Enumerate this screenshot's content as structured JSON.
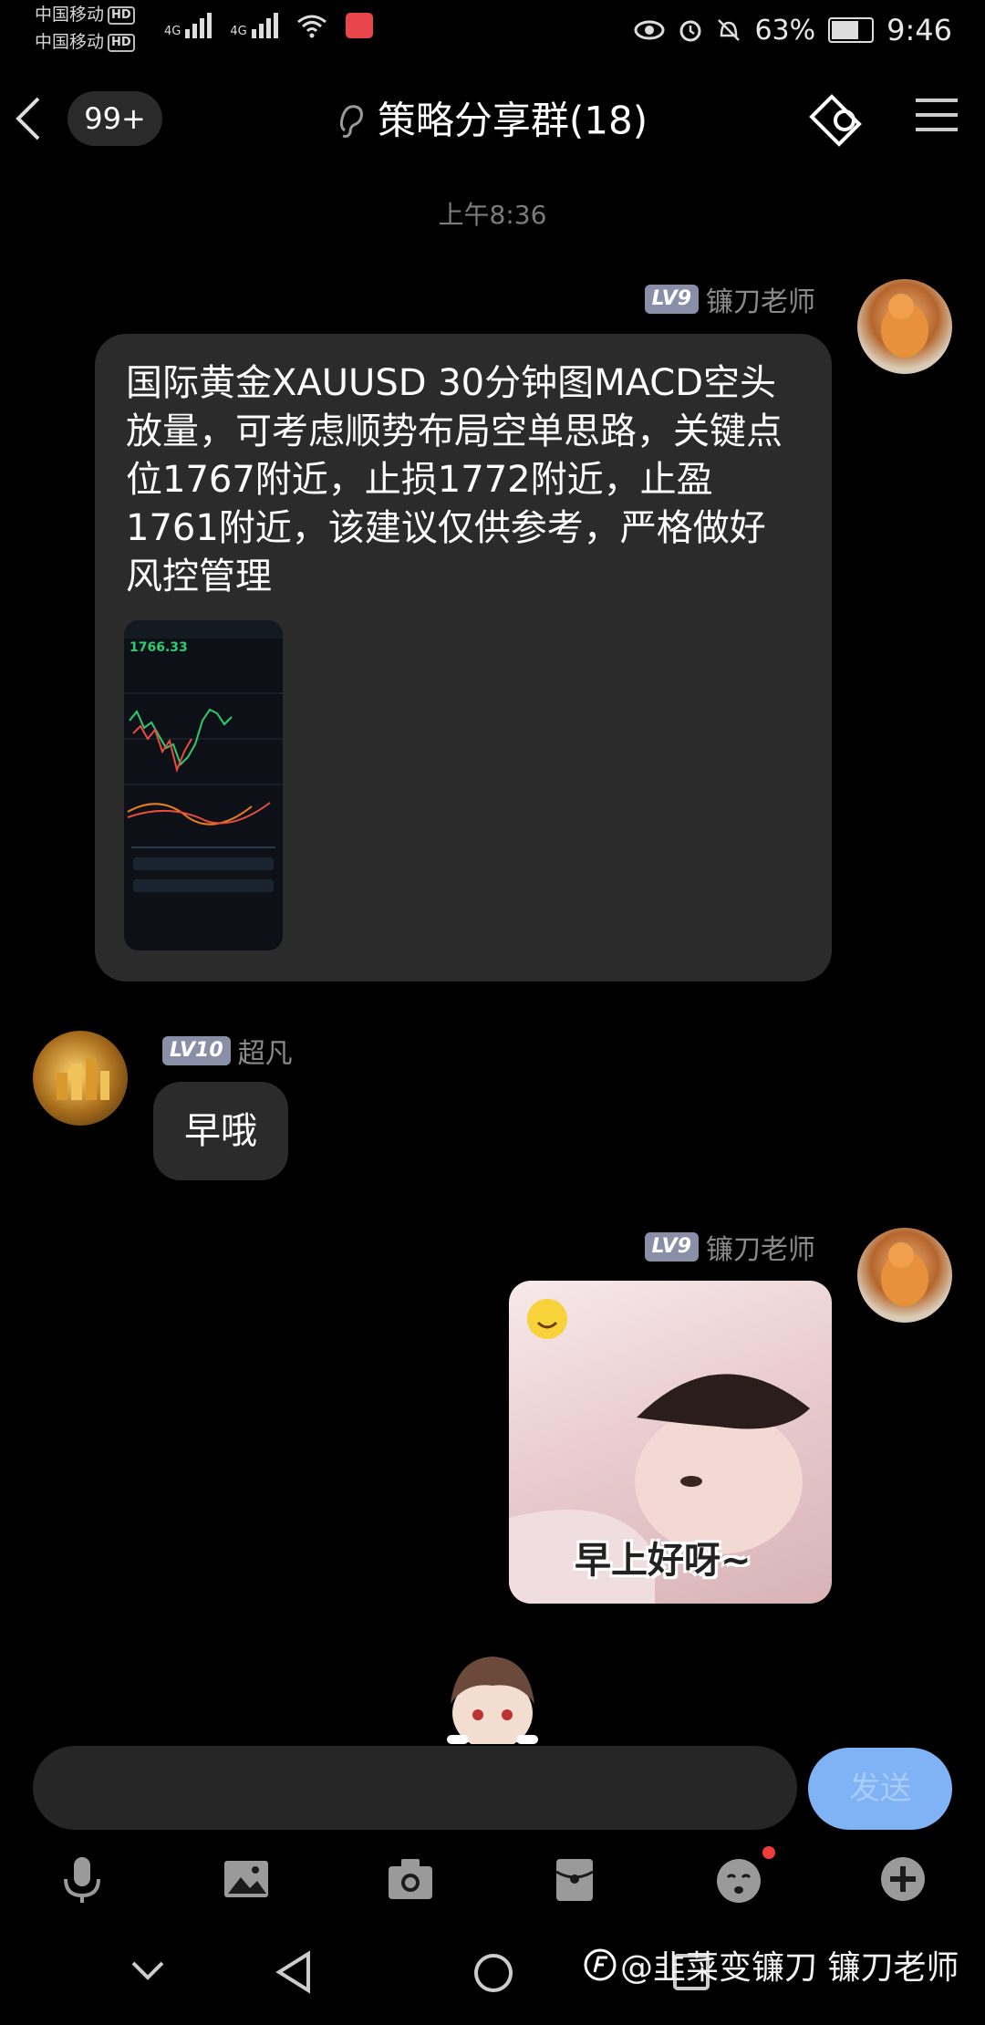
{
  "status_bar": {
    "carrier1": "中国移动",
    "carrier2": "中国移动",
    "hd": "HD",
    "net1": "4G",
    "net2": "4G",
    "battery": "63%",
    "clock": "9:46"
  },
  "header": {
    "unread_badge": "99+",
    "title": "策略分享群(18)"
  },
  "messages": [
    {
      "type": "time",
      "text": "上午8:36"
    },
    {
      "type": "msg",
      "side": "right",
      "level": "LV9",
      "nick": "镰刀老师",
      "text": "国际黄金XAUUSD 30分钟图MACD空头放量，可考虑顺势布局空单思路，关键点位1767附近，止损1772附近，止盈1761附近，该建议仅供参考，严格做好风控管理",
      "image_price": "1766.33"
    },
    {
      "type": "msg",
      "side": "left",
      "level": "LV10",
      "nick": "超凡",
      "text": "早哦"
    },
    {
      "type": "msg",
      "side": "right",
      "level": "LV9",
      "nick": "镰刀老师",
      "sticker_caption": "早上好呀~"
    }
  ],
  "input": {
    "placeholder": "",
    "send_label": "发送"
  },
  "toolbar": [
    "mic-icon",
    "image-icon",
    "camera-icon",
    "redpacket-icon",
    "emoji-icon",
    "plus-icon"
  ],
  "watermark": "@韭菜变镰刀 镰刀老师",
  "colors": {
    "background": "#000000",
    "bubble": "#2b2b2b",
    "send_button": "#7fb3f5",
    "level_badge": "#8a8fa8"
  }
}
